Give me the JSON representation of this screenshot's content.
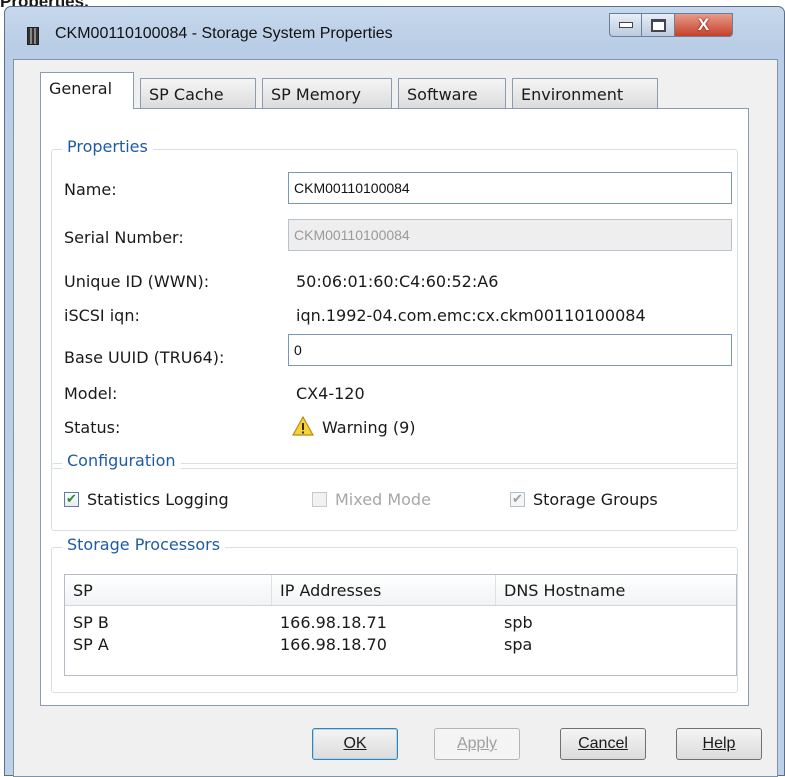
{
  "doc_heading": "Properties.",
  "window": {
    "title": "CKM00110100084 - Storage System Properties",
    "min_label": "",
    "close_label": "X"
  },
  "tabs": [
    {
      "label": "General",
      "active": true
    },
    {
      "label": "SP Cache",
      "active": false
    },
    {
      "label": "SP Memory",
      "active": false
    },
    {
      "label": "Software",
      "active": false
    },
    {
      "label": "Environment",
      "active": false
    }
  ],
  "properties": {
    "title": "Properties",
    "name_label": "Name:",
    "name_value": "CKM00110100084",
    "serial_label": "Serial Number:",
    "serial_value": "CKM00110100084",
    "wwn_label": "Unique ID (WWN):",
    "wwn_value": "50:06:01:60:C4:60:52:A6",
    "iqn_label": "iSCSI iqn:",
    "iqn_value": "iqn.1992-04.com.emc:cx.ckm00110100084",
    "uuid_label": "Base UUID (TRU64):",
    "uuid_value": "0",
    "model_label": "Model:",
    "model_value": "CX4-120",
    "status_label": "Status:",
    "status_value": "Warning (9)",
    "status_icon": "warning-icon"
  },
  "configuration": {
    "title": "Configuration",
    "stats_logging": {
      "label": "Statistics Logging",
      "checked": true,
      "enabled": true
    },
    "mixed_mode": {
      "label": "Mixed Mode",
      "checked": false,
      "enabled": false
    },
    "storage_groups": {
      "label": "Storage Groups",
      "checked": true,
      "enabled": false
    }
  },
  "storage_processors": {
    "title": "Storage Processors",
    "columns": [
      "SP",
      "IP Addresses",
      "DNS Hostname"
    ],
    "rows": [
      [
        "SP B",
        "166.98.18.71",
        "spb"
      ],
      [
        "SP A",
        "166.98.18.70",
        "spa"
      ]
    ]
  },
  "buttons": {
    "ok": "OK",
    "apply": "Apply",
    "cancel": "Cancel",
    "help": "Help"
  },
  "colors": {
    "group_title": "#1f5aa6",
    "close_button": "#c6402a",
    "titlebar": "#bcd0e7"
  }
}
